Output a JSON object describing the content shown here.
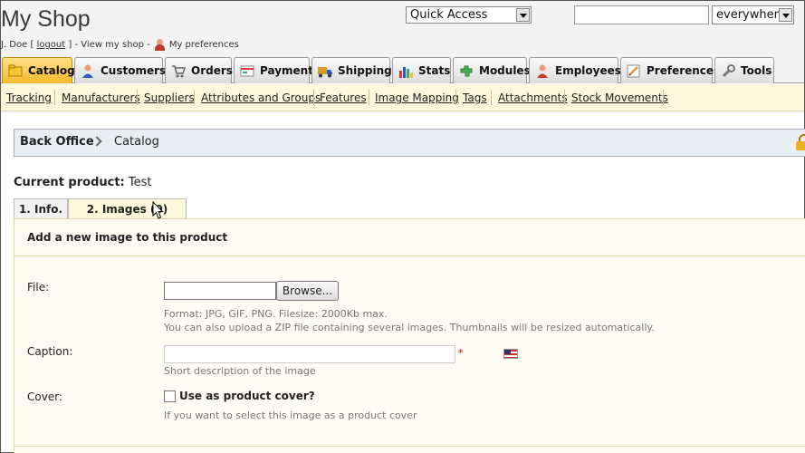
{
  "header": {
    "shop_title": "My Shop",
    "user_name": "J. Doe",
    "logout_open": "[",
    "logout": "logout",
    "logout_close": "]",
    "sep1": "-",
    "view_shop": "View my shop",
    "sep2": "-",
    "my_preferences": "My preferences",
    "quick_access": "Quick Access",
    "search_value": "",
    "search_scope": "everywhere"
  },
  "tabs": [
    {
      "label": "Catalog",
      "icon": "catalog-icon"
    },
    {
      "label": "Customers",
      "icon": "customers-icon"
    },
    {
      "label": "Orders",
      "icon": "orders-icon"
    },
    {
      "label": "Payment",
      "icon": "payment-icon"
    },
    {
      "label": "Shipping",
      "icon": "shipping-icon"
    },
    {
      "label": "Stats",
      "icon": "stats-icon"
    },
    {
      "label": "Modules",
      "icon": "modules-icon"
    },
    {
      "label": "Employees",
      "icon": "employees-icon"
    },
    {
      "label": "Preferences",
      "icon": "preferences-icon"
    },
    {
      "label": "Tools",
      "icon": "tools-icon"
    }
  ],
  "subnav": [
    "Tracking",
    "Manufacturers",
    "Suppliers",
    "Attributes and Groups",
    "Features",
    "Image Mapping",
    "Tags",
    "Attachments",
    "Stock Movements"
  ],
  "breadcrumb": {
    "root": "Back Office",
    "current": "Catalog"
  },
  "product": {
    "label": "Current product:",
    "name": "Test"
  },
  "product_tabs": {
    "info": "1. Info.",
    "images": "2. Images (0)"
  },
  "form": {
    "heading": "Add a new image to this product",
    "file_label": "File:",
    "browse": "Browse...",
    "format_hint": "Format: JPG, GIF, PNG. Filesize: 2000Kb max.",
    "zip_hint": "You can also upload a ZIP file containing several images. Thumbnails will be resized automatically.",
    "caption_label": "Caption:",
    "caption_value": "",
    "required_mark": "*",
    "caption_hint": "Short description of the image",
    "cover_label": "Cover:",
    "cover_checkbox": "Use as product cover?",
    "cover_hint": "If you want to select this image as a product cover"
  }
}
